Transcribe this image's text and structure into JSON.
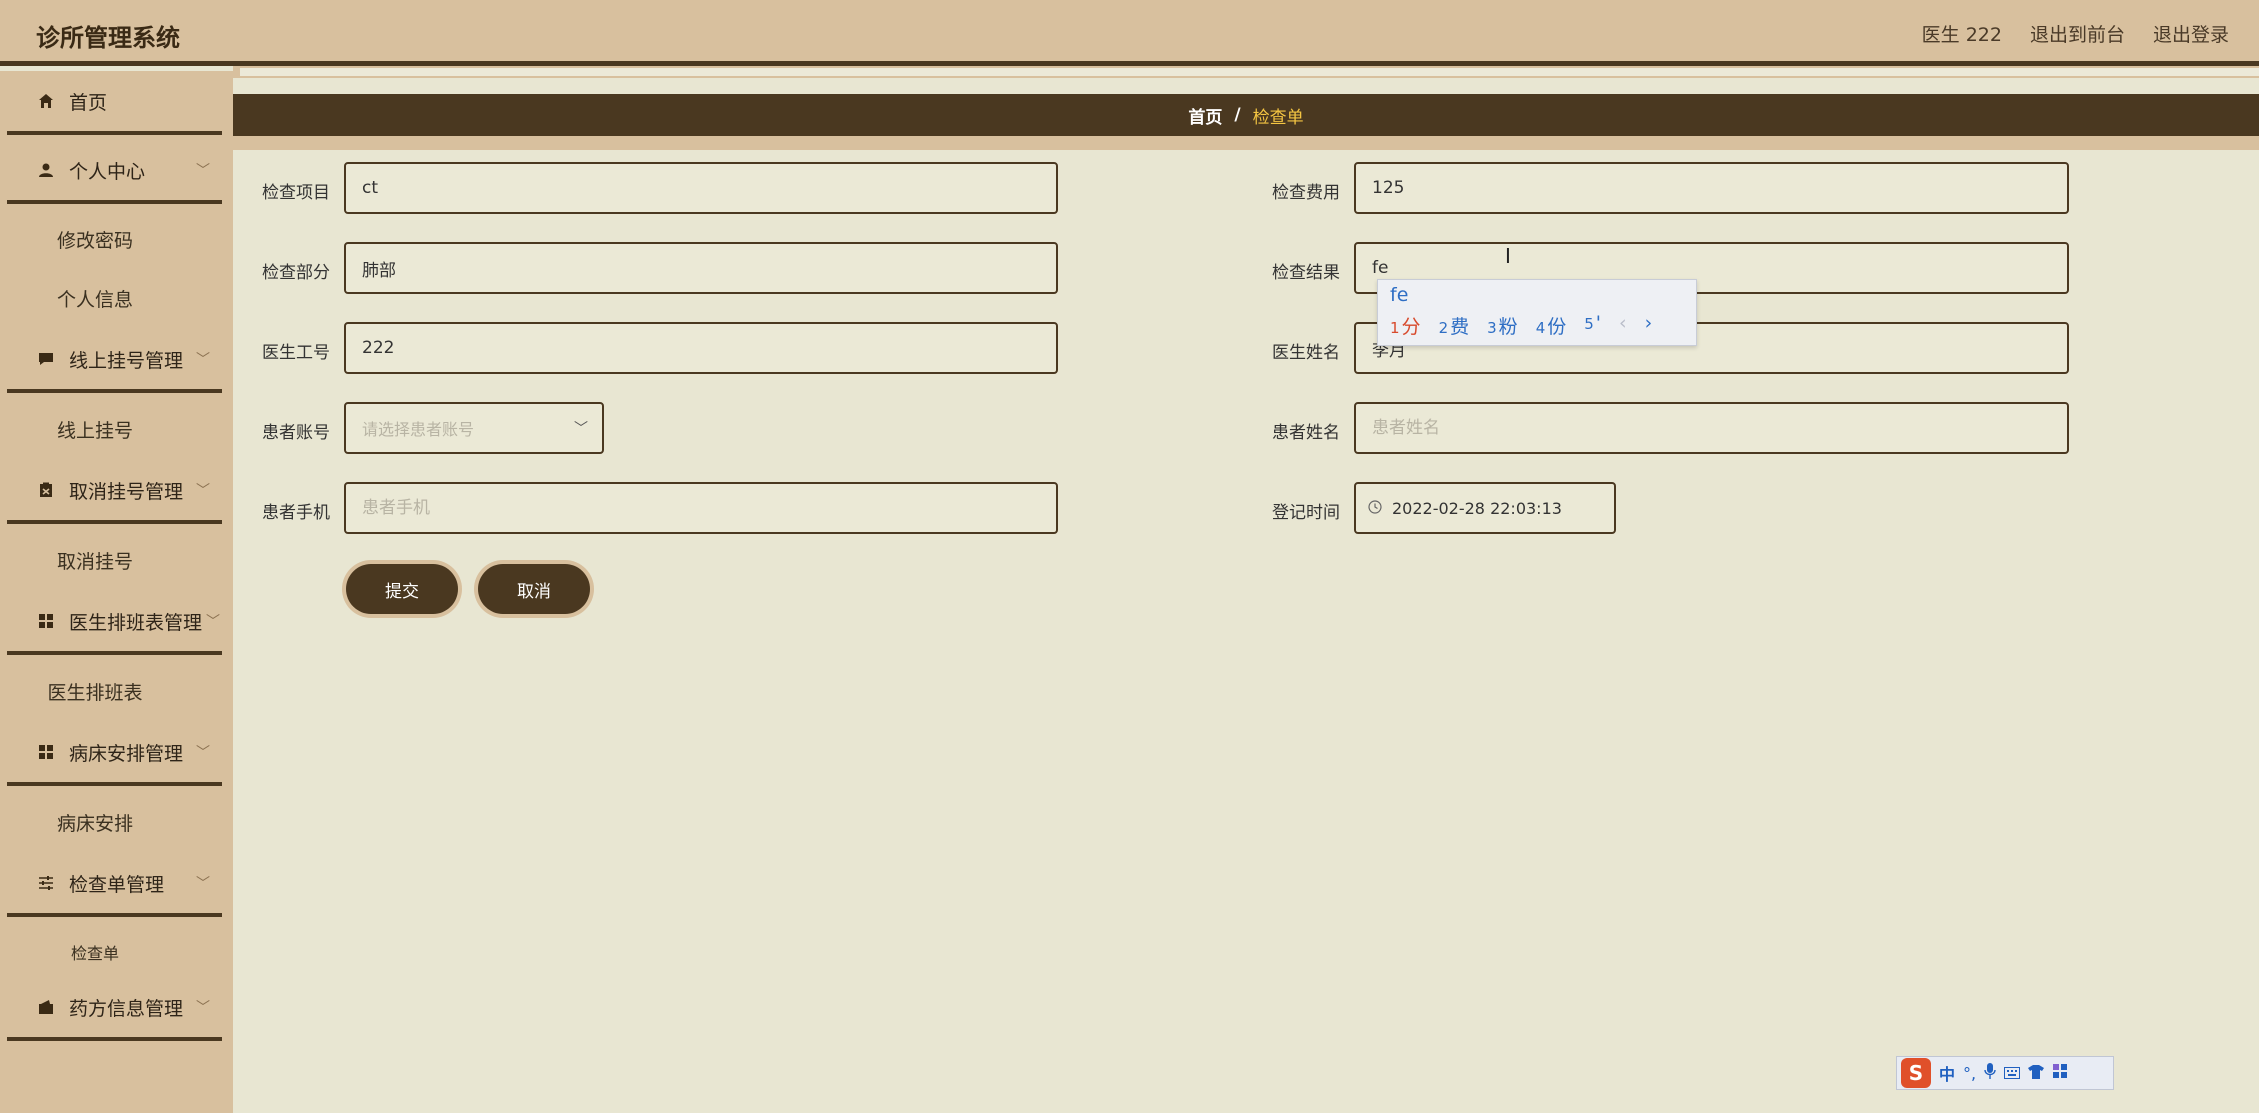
{
  "header": {
    "app_title": "诊所管理系统",
    "user": "医生 222",
    "back_to_front": "退出到前台",
    "logout": "退出登录"
  },
  "sidebar": {
    "home": "首页",
    "personal_center": "个人中心",
    "change_password": "修改密码",
    "personal_info": "个人信息",
    "online_reg_mgmt": "线上挂号管理",
    "online_reg": "线上挂号",
    "cancel_reg_mgmt": "取消挂号管理",
    "cancel_reg": "取消挂号",
    "schedule_mgmt": "医生排班表管理",
    "schedule": "医生排班表",
    "bed_mgmt": "病床安排管理",
    "bed": "病床安排",
    "exam_mgmt": "检查单管理",
    "exam": "检查单",
    "prescription_mgmt": "药方信息管理"
  },
  "breadcrumb": {
    "home": "首页",
    "sep": "/",
    "current": "检查单"
  },
  "form": {
    "exam_item": {
      "label": "检查项目",
      "value": "ct"
    },
    "exam_fee": {
      "label": "检查费用",
      "value": "125"
    },
    "exam_part": {
      "label": "检查部分",
      "value": "肺部"
    },
    "exam_result": {
      "label": "检查结果",
      "value": "fe"
    },
    "doctor_id": {
      "label": "医生工号",
      "value": "222"
    },
    "doctor_name": {
      "label": "医生姓名",
      "value": "李月"
    },
    "patient_account": {
      "label": "患者账号",
      "placeholder": "请选择患者账号"
    },
    "patient_name": {
      "label": "患者姓名",
      "placeholder": "患者姓名"
    },
    "patient_phone": {
      "label": "患者手机",
      "placeholder": "患者手机"
    },
    "register_time": {
      "label": "登记时间",
      "value": "2022-02-28 22:03:13"
    }
  },
  "buttons": {
    "submit": "提交",
    "cancel": "取消"
  },
  "ime": {
    "composition": "fe",
    "candidates": [
      {
        "num": "1",
        "text": "分"
      },
      {
        "num": "2",
        "text": "费"
      },
      {
        "num": "3",
        "text": "粉"
      },
      {
        "num": "4",
        "text": "份"
      },
      {
        "num": "5",
        "text": "'"
      }
    ],
    "bar_lang": "中"
  },
  "colors": {
    "header_bg": "#d8c09e",
    "dark_brown": "#4a3820",
    "content_bg": "#e8e6d2",
    "breadcrumb_current": "#f4c542"
  }
}
